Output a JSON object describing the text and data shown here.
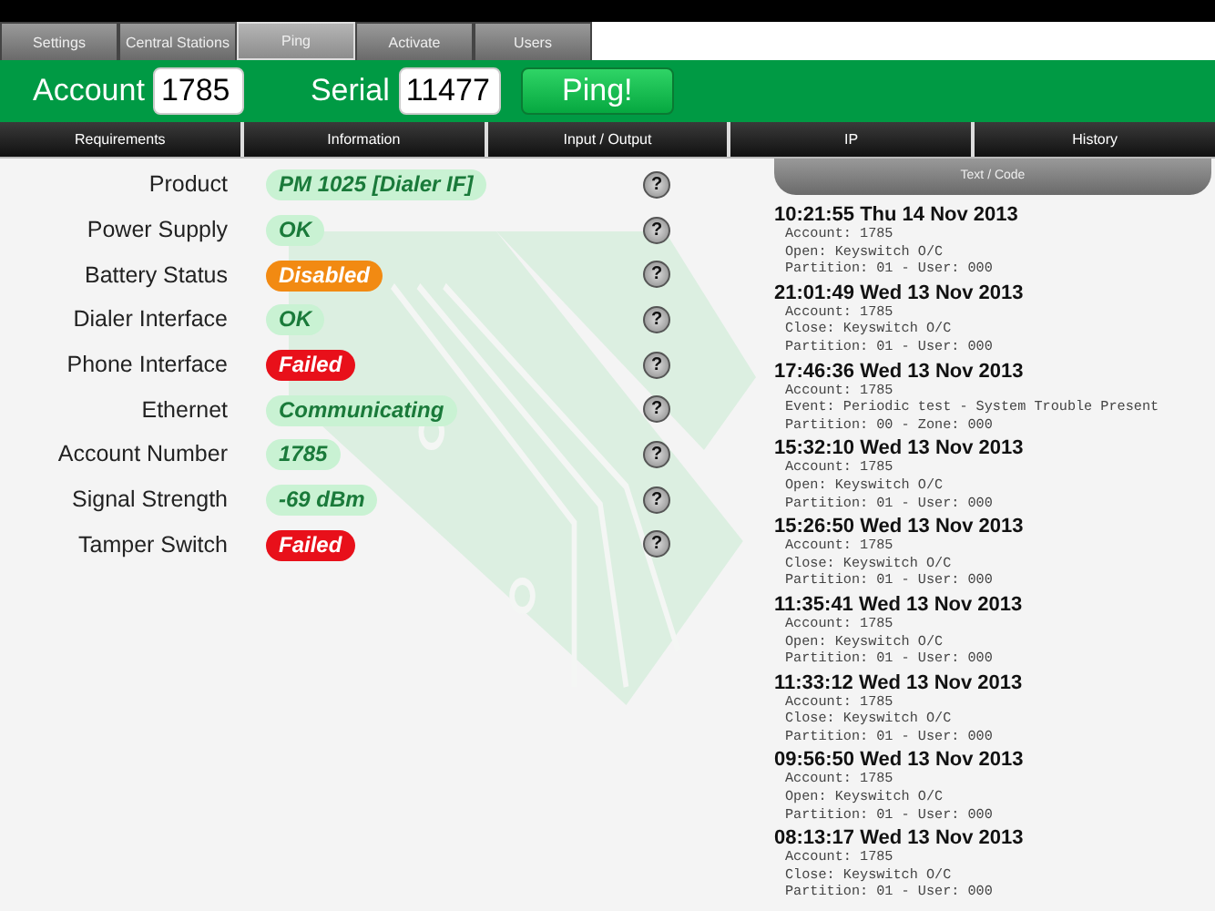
{
  "tabs": [
    {
      "label": "Settings",
      "selected": false
    },
    {
      "label": "Central Stations",
      "selected": false
    },
    {
      "label": "Ping",
      "selected": true
    },
    {
      "label": "Activate",
      "selected": false
    },
    {
      "label": "Users",
      "selected": false
    }
  ],
  "toolbar": {
    "account_label": "Account",
    "account_value": "1785",
    "serial_label": "Serial",
    "serial_value": "11477",
    "ping_button": "Ping!"
  },
  "sections": [
    {
      "label": "Requirements",
      "selected": false
    },
    {
      "label": "Information",
      "selected": false
    },
    {
      "label": "Input / Output",
      "selected": false
    },
    {
      "label": "IP",
      "selected": false
    },
    {
      "label": "History",
      "selected": false
    }
  ],
  "info_rows": [
    {
      "label": "Product",
      "value": "PM 1025 [Dialer IF]",
      "kind": "ok",
      "help": "?"
    },
    {
      "label": "Power Supply",
      "value": "OK",
      "kind": "ok",
      "help": "?"
    },
    {
      "label": "Battery Status",
      "value": "Disabled",
      "kind": "warning",
      "help": "?"
    },
    {
      "label": "Dialer Interface",
      "value": "OK",
      "kind": "ok",
      "help": "?"
    },
    {
      "label": "Phone Interface",
      "value": "Failed",
      "kind": "error",
      "help": "?"
    },
    {
      "label": "Ethernet",
      "value": "Communicating",
      "kind": "ok",
      "help": "?"
    },
    {
      "label": "Account Number",
      "value": "1785",
      "kind": "ok",
      "help": "?"
    },
    {
      "label": "Signal Strength",
      "value": "-69 dBm",
      "kind": "ok",
      "help": "?"
    },
    {
      "label": "Tamper Switch",
      "value": "Failed",
      "kind": "error",
      "help": "?"
    }
  ],
  "log": {
    "header": "Text / Code",
    "events": [
      {
        "time": "10:21:55 Thu 14 Nov 2013",
        "lines": [
          "Account: 1785",
          "Open: Keyswitch O/C",
          "Partition: 01 - User: 000"
        ]
      },
      {
        "time": "21:01:49 Wed 13 Nov 2013",
        "lines": [
          "Account: 1785",
          "Close: Keyswitch O/C",
          "Partition: 01 - User: 000"
        ]
      },
      {
        "time": "17:46:36 Wed 13 Nov 2013",
        "lines": [
          "Account: 1785",
          "Event: Periodic test - System Trouble Present",
          "Partition: 00 - Zone: 000"
        ]
      },
      {
        "time": "15:32:10 Wed 13 Nov 2013",
        "lines": [
          "Account: 1785",
          "Open: Keyswitch O/C",
          "Partition: 01 - User: 000"
        ]
      },
      {
        "time": "15:26:50 Wed 13 Nov 2013",
        "lines": [
          "Account: 1785",
          "Close: Keyswitch O/C",
          "Partition: 01 - User: 000"
        ]
      },
      {
        "time": "11:35:41 Wed 13 Nov 2013",
        "lines": [
          "Account: 1785",
          "Open: Keyswitch O/C",
          "Partition: 01 - User: 000"
        ]
      },
      {
        "time": "11:33:12 Wed 13 Nov 2013",
        "lines": [
          "Account: 1785",
          "Close: Keyswitch O/C",
          "Partition: 01 - User: 000"
        ]
      },
      {
        "time": "09:56:50 Wed 13 Nov 2013",
        "lines": [
          "Account: 1785",
          "Open: Keyswitch O/C",
          "Partition: 01 - User: 000"
        ]
      },
      {
        "time": "08:13:17 Wed 13 Nov 2013",
        "lines": [
          "Account: 1785",
          "Close: Keyswitch O/C",
          "Partition: 01 - User: 000"
        ]
      }
    ]
  }
}
